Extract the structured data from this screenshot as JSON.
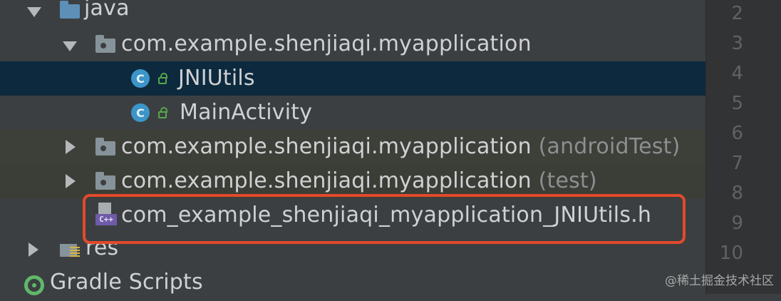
{
  "tree": {
    "java": {
      "label": "java"
    },
    "pkg_main": {
      "label": "com.example.shenjiaqi.myapplication"
    },
    "jniutils": {
      "label": "JNIUtils",
      "icon_letter": "C"
    },
    "mainactivity": {
      "label": "MainActivity",
      "icon_letter": "C"
    },
    "pkg_androidtest": {
      "label": "com.example.shenjiaqi.myapplication",
      "suffix": "(androidTest)"
    },
    "pkg_test": {
      "label": "com.example.shenjiaqi.myapplication",
      "suffix": "(test)"
    },
    "header_file": {
      "label": "com_example_shenjiaqi_myapplication_JNIUtils.h",
      "icon_tag": "C++"
    },
    "res": {
      "label": "res"
    },
    "gradle": {
      "label": "Gradle Scripts"
    }
  },
  "gutter": {
    "line_numbers": [
      "2",
      "3",
      "4",
      "5",
      "6",
      "7",
      "8",
      "9",
      "10"
    ]
  },
  "watermark": "@稀土掘金技术社区",
  "colors": {
    "background": "#3c3f41",
    "selected_row": "#0d293e",
    "highlight_border": "#e24a2c",
    "class_icon": "#3c95c8",
    "cpp_tag": "#6e5aa8"
  }
}
